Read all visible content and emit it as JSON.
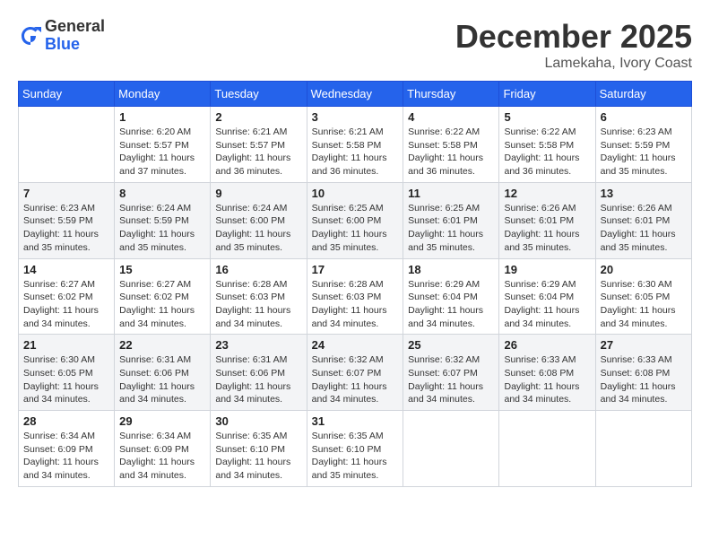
{
  "header": {
    "logo_general": "General",
    "logo_blue": "Blue",
    "month": "December 2025",
    "location": "Lamekaha, Ivory Coast"
  },
  "weekdays": [
    "Sunday",
    "Monday",
    "Tuesday",
    "Wednesday",
    "Thursday",
    "Friday",
    "Saturday"
  ],
  "weeks": [
    [
      {
        "day": "",
        "empty": true
      },
      {
        "day": "1",
        "sunrise": "6:20 AM",
        "sunset": "5:57 PM",
        "daylight": "11 hours and 37 minutes."
      },
      {
        "day": "2",
        "sunrise": "6:21 AM",
        "sunset": "5:57 PM",
        "daylight": "11 hours and 36 minutes."
      },
      {
        "day": "3",
        "sunrise": "6:21 AM",
        "sunset": "5:58 PM",
        "daylight": "11 hours and 36 minutes."
      },
      {
        "day": "4",
        "sunrise": "6:22 AM",
        "sunset": "5:58 PM",
        "daylight": "11 hours and 36 minutes."
      },
      {
        "day": "5",
        "sunrise": "6:22 AM",
        "sunset": "5:58 PM",
        "daylight": "11 hours and 36 minutes."
      },
      {
        "day": "6",
        "sunrise": "6:23 AM",
        "sunset": "5:59 PM",
        "daylight": "11 hours and 35 minutes."
      }
    ],
    [
      {
        "day": "7",
        "sunrise": "6:23 AM",
        "sunset": "5:59 PM",
        "daylight": "11 hours and 35 minutes."
      },
      {
        "day": "8",
        "sunrise": "6:24 AM",
        "sunset": "5:59 PM",
        "daylight": "11 hours and 35 minutes."
      },
      {
        "day": "9",
        "sunrise": "6:24 AM",
        "sunset": "6:00 PM",
        "daylight": "11 hours and 35 minutes."
      },
      {
        "day": "10",
        "sunrise": "6:25 AM",
        "sunset": "6:00 PM",
        "daylight": "11 hours and 35 minutes."
      },
      {
        "day": "11",
        "sunrise": "6:25 AM",
        "sunset": "6:01 PM",
        "daylight": "11 hours and 35 minutes."
      },
      {
        "day": "12",
        "sunrise": "6:26 AM",
        "sunset": "6:01 PM",
        "daylight": "11 hours and 35 minutes."
      },
      {
        "day": "13",
        "sunrise": "6:26 AM",
        "sunset": "6:01 PM",
        "daylight": "11 hours and 35 minutes."
      }
    ],
    [
      {
        "day": "14",
        "sunrise": "6:27 AM",
        "sunset": "6:02 PM",
        "daylight": "11 hours and 34 minutes."
      },
      {
        "day": "15",
        "sunrise": "6:27 AM",
        "sunset": "6:02 PM",
        "daylight": "11 hours and 34 minutes."
      },
      {
        "day": "16",
        "sunrise": "6:28 AM",
        "sunset": "6:03 PM",
        "daylight": "11 hours and 34 minutes."
      },
      {
        "day": "17",
        "sunrise": "6:28 AM",
        "sunset": "6:03 PM",
        "daylight": "11 hours and 34 minutes."
      },
      {
        "day": "18",
        "sunrise": "6:29 AM",
        "sunset": "6:04 PM",
        "daylight": "11 hours and 34 minutes."
      },
      {
        "day": "19",
        "sunrise": "6:29 AM",
        "sunset": "6:04 PM",
        "daylight": "11 hours and 34 minutes."
      },
      {
        "day": "20",
        "sunrise": "6:30 AM",
        "sunset": "6:05 PM",
        "daylight": "11 hours and 34 minutes."
      }
    ],
    [
      {
        "day": "21",
        "sunrise": "6:30 AM",
        "sunset": "6:05 PM",
        "daylight": "11 hours and 34 minutes."
      },
      {
        "day": "22",
        "sunrise": "6:31 AM",
        "sunset": "6:06 PM",
        "daylight": "11 hours and 34 minutes."
      },
      {
        "day": "23",
        "sunrise": "6:31 AM",
        "sunset": "6:06 PM",
        "daylight": "11 hours and 34 minutes."
      },
      {
        "day": "24",
        "sunrise": "6:32 AM",
        "sunset": "6:07 PM",
        "daylight": "11 hours and 34 minutes."
      },
      {
        "day": "25",
        "sunrise": "6:32 AM",
        "sunset": "6:07 PM",
        "daylight": "11 hours and 34 minutes."
      },
      {
        "day": "26",
        "sunrise": "6:33 AM",
        "sunset": "6:08 PM",
        "daylight": "11 hours and 34 minutes."
      },
      {
        "day": "27",
        "sunrise": "6:33 AM",
        "sunset": "6:08 PM",
        "daylight": "11 hours and 34 minutes."
      }
    ],
    [
      {
        "day": "28",
        "sunrise": "6:34 AM",
        "sunset": "6:09 PM",
        "daylight": "11 hours and 34 minutes."
      },
      {
        "day": "29",
        "sunrise": "6:34 AM",
        "sunset": "6:09 PM",
        "daylight": "11 hours and 34 minutes."
      },
      {
        "day": "30",
        "sunrise": "6:35 AM",
        "sunset": "6:10 PM",
        "daylight": "11 hours and 34 minutes."
      },
      {
        "day": "31",
        "sunrise": "6:35 AM",
        "sunset": "6:10 PM",
        "daylight": "11 hours and 35 minutes."
      },
      {
        "day": "",
        "empty": true
      },
      {
        "day": "",
        "empty": true
      },
      {
        "day": "",
        "empty": true
      }
    ]
  ],
  "labels": {
    "sunrise": "Sunrise:",
    "sunset": "Sunset:",
    "daylight": "Daylight:"
  }
}
